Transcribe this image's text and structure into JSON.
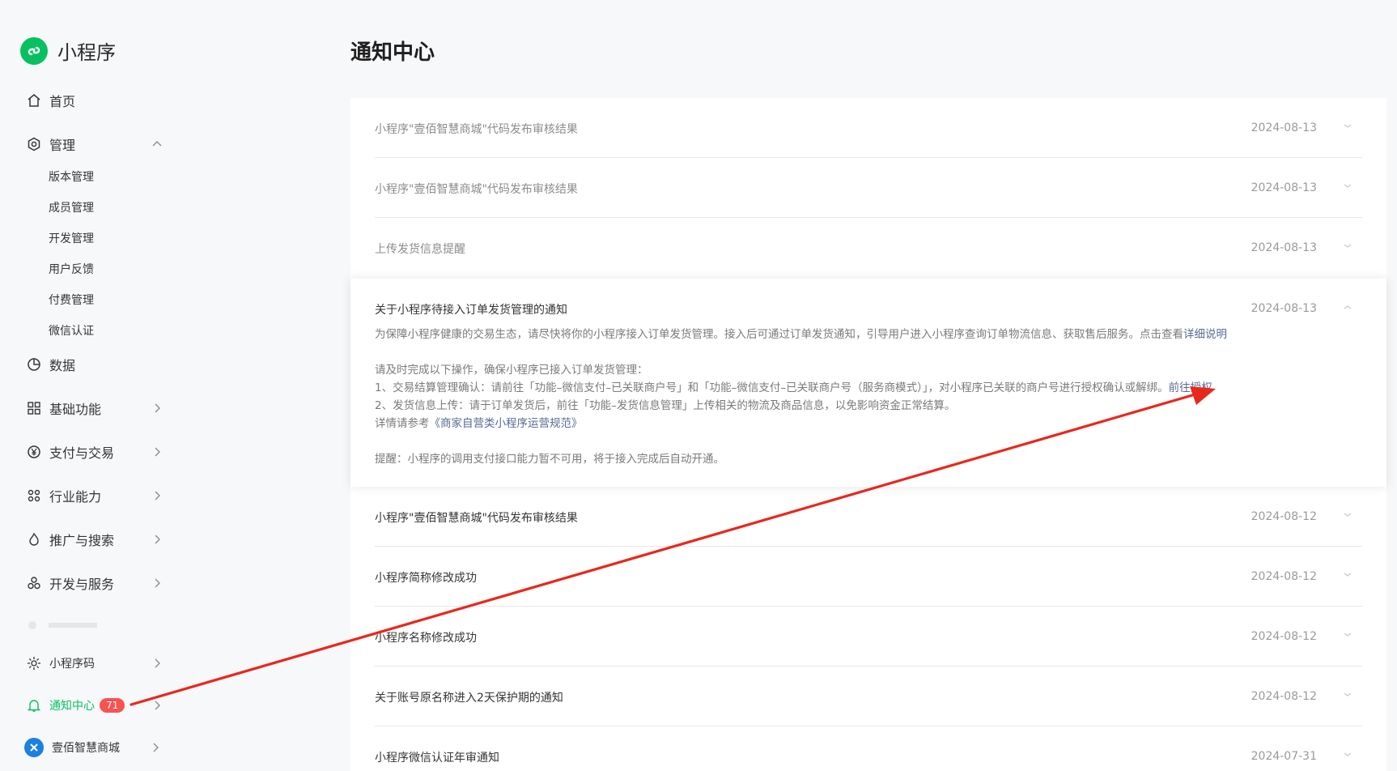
{
  "sidebar": {
    "brand": "小程序",
    "nav": {
      "home": "首页",
      "manage": "管理",
      "manage_sub": [
        "版本管理",
        "成员管理",
        "开发管理",
        "用户反馈",
        "付费管理",
        "微信认证"
      ],
      "data": "数据",
      "basic": "基础功能",
      "pay": "支付与交易",
      "industry": "行业能力",
      "promote": "推广与搜索",
      "dev": "开发与服务"
    },
    "bottom": {
      "qrcode": "小程序码",
      "notify": "通知中心",
      "notify_badge": "71",
      "account": "壹佰智慧商城"
    }
  },
  "main": {
    "title": "通知中心",
    "notifications": [
      {
        "title": "小程序\"壹佰智慧商城\"代码发布审核结果",
        "date": "2024-08-13"
      },
      {
        "title": "小程序\"壹佰智慧商城\"代码发布审核结果",
        "date": "2024-08-13"
      },
      {
        "title": "上传发货信息提醒",
        "date": "2024-08-13"
      },
      {
        "title": "小程序\"壹佰智慧商城\"代码发布审核结果",
        "date": "2024-08-12"
      },
      {
        "title": "小程序简称修改成功",
        "date": "2024-08-12"
      },
      {
        "title": "小程序名称修改成功",
        "date": "2024-08-12"
      },
      {
        "title": "关于账号原名称进入2天保护期的通知",
        "date": "2024-08-12"
      },
      {
        "title": "小程序微信认证年审通知",
        "date": "2024-07-31"
      }
    ],
    "expanded": {
      "title": "关于小程序待接入订单发货管理的通知",
      "date": "2024-08-13",
      "intro": "为保障小程序健康的交易生态，请尽快将你的小程序接入订单发货管理。接入后可通过订单发货通知，引导用户进入小程序查询订单物流信息、获取售后服务。点击查看",
      "intro_link": "详细说明",
      "steps_head": "请及时完成以下操作，确保小程序已接入订单发货管理：",
      "step1": "1、交易结算管理确认：请前往「功能–微信支付–已关联商户号」和「功能–微信支付–已关联商户号（服务商模式）」，对小程序已关联的商户号进行授权确认或解绑。",
      "step1_link": "前往授权",
      "step2": "2、发货信息上传：请于订单发货后，前往「功能–发货信息管理」上传相关的物流及商品信息，以免影响资金正常结算。",
      "ref": "详情请参考",
      "ref_link": "《商家自营类小程序运营规范》",
      "tip": "提醒：小程序的调用支付接口能力暂不可用，将于接入完成后自动开通。"
    }
  },
  "colors": {
    "brand_green": "#07c160",
    "badge_red": "#fa5151",
    "link_blue": "#576b95",
    "arrow_red": "#e8281c"
  }
}
